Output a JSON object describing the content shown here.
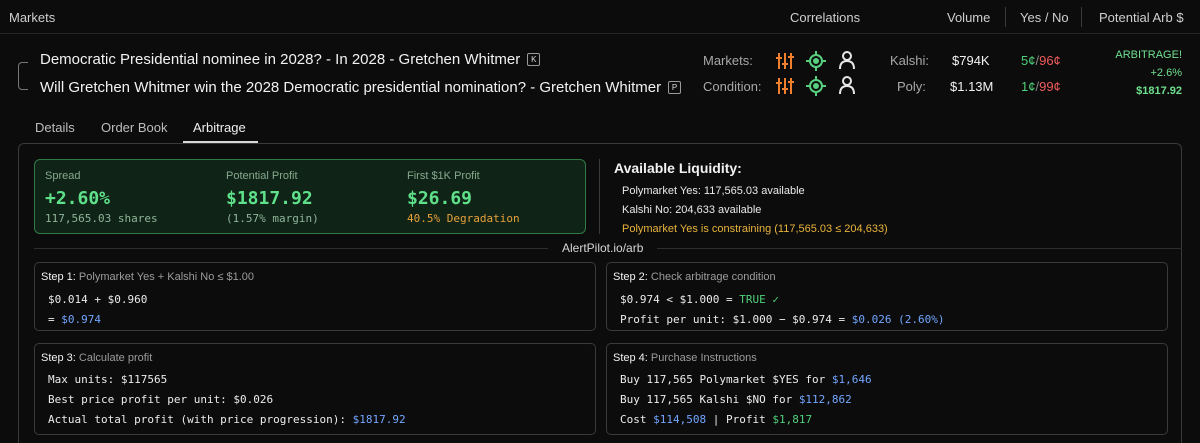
{
  "header": {
    "markets": "Markets",
    "correlations": "Correlations",
    "volume": "Volume",
    "yes_no": "Yes / No",
    "potential_arb": "Potential Arb $"
  },
  "market": {
    "title1": "Democratic Presidential nominee in 2028? - In 2028 - Gretchen Whitmer",
    "tag1": "K",
    "title2": "Will Gretchen Whitmer win the 2028 Democratic presidential nomination? - Gretchen Whitmer",
    "tag2": "P",
    "markets_label": "Markets:",
    "condition_label": "Condition:",
    "kalshi_label": "Kalshi:",
    "kalshi_volume": "$794K",
    "poly_label": "Poly:",
    "poly_volume": "$1.13M",
    "kalshi_yes": "5¢",
    "kalshi_no": "96¢",
    "poly_yes": "1¢",
    "poly_no": "99¢",
    "slash": "/",
    "arb_status": "ARBITRAGE!",
    "arb_pct": "+2.6%",
    "arb_amount": "$1817.92",
    "icon_colors": {
      "sliders": "#f07f2e",
      "target": "#57d07e",
      "user": "#e6e6e6"
    }
  },
  "tabs": [
    {
      "label": "Details"
    },
    {
      "label": "Order Book"
    },
    {
      "label": "Arbitrage",
      "active": true
    }
  ],
  "summary": {
    "spread_label": "Spread",
    "spread_value": "+2.60%",
    "spread_sub": "117,565.03 shares",
    "profit_label": "Potential Profit",
    "profit_value": "$1817.92",
    "profit_sub": "(1.57% margin)",
    "first1k_label": "First $1K Profit",
    "first1k_value": "$26.69",
    "first1k_sub": "40.5% Degradation"
  },
  "liquidity": {
    "title": "Available Liquidity:",
    "poly_yes": "Polymarket Yes: 117,565.03 available",
    "kalshi_no": "Kalshi No: 204,633 available",
    "constraint": "Polymarket Yes is constraining (117,565.03 ≤ 204,633)"
  },
  "divider_label": "AlertPilot.io/arb",
  "steps": {
    "s1_title": "Step 1:",
    "s1_sub": "Polymarket Yes + Kalshi No ≤ $1.00",
    "s1_line1": "$0.014 + $0.960",
    "s1_line2_prefix": "= ",
    "s1_line2_val": "$0.974",
    "s2_title": "Step 2:",
    "s2_sub": "Check arbitrage condition",
    "s2_line1_prefix": "$0.974 < $1.000 = ",
    "s2_line1_val": "TRUE ✓",
    "s2_line2_prefix": "Profit per unit: $1.000 − $0.974 = ",
    "s2_line2_val": "$0.026 (2.60%)",
    "s3_title": "Step 3:",
    "s3_sub": "Calculate profit",
    "s3_line1": "Max units: $117565",
    "s3_line2": "Best price profit per unit: $0.026",
    "s3_line3_prefix": "Actual total profit (with price progression): ",
    "s3_line3_val": "$1817.92",
    "s4_title": "Step 4:",
    "s4_sub": "Purchase Instructions",
    "s4_line1_prefix": "Buy 117,565 Polymarket $YES for ",
    "s4_line1_val": "$1,646",
    "s4_line2_prefix": "Buy 117,565 Kalshi $NO for ",
    "s4_line2_val": "$112,862",
    "s4_line3_a": "Cost ",
    "s4_line3_b": "$114,508",
    "s4_line3_c": " | Profit ",
    "s4_line3_d": "$1,817"
  }
}
